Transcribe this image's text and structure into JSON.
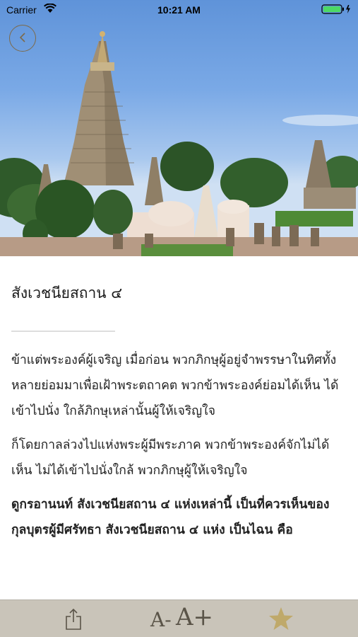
{
  "status_bar": {
    "carrier": "Carrier",
    "time": "10:21 AM"
  },
  "hero": {
    "image": "temple-stupa-photo"
  },
  "article": {
    "title": "สังเวชนียสถาน ๔",
    "paragraphs": [
      "ข้าแต่พระองค์ผู้เจริญ เมื่อก่อน พวกภิกษุผู้อยู่จำพรรษาในทิศทั้งหลายย่อมมาเพื่อเฝ้าพระตถาคต พวกข้าพระองค์ย่อมได้เห็น ได้เข้าไปนั่ง ใกล้ภิกษุเหล่านั้นผู้ให้เจริญใจ",
      "ก็โดยกาลล่วงไปแห่งพระผู้มีพระภาค พวกข้าพระองค์จักไม่ได้เห็น ไม่ได้เข้าไปนั่งใกล้ พวกภิกษุผู้ให้เจริญใจ",
      "ดูกรอานนท์ สังเวชนียสถาน ๔ แห่งเหล่านี้ เป็นที่ควรเห็นของกุลบุตรผู้มีศรัทธา สังเวชนียสถาน ๔ แห่ง เป็นไฉน คือ"
    ]
  },
  "toolbar": {
    "font_smaller": "A-",
    "font_larger": "A+",
    "icons": [
      "share-icon",
      "star-icon"
    ],
    "accent_color": "#bfa96a"
  }
}
